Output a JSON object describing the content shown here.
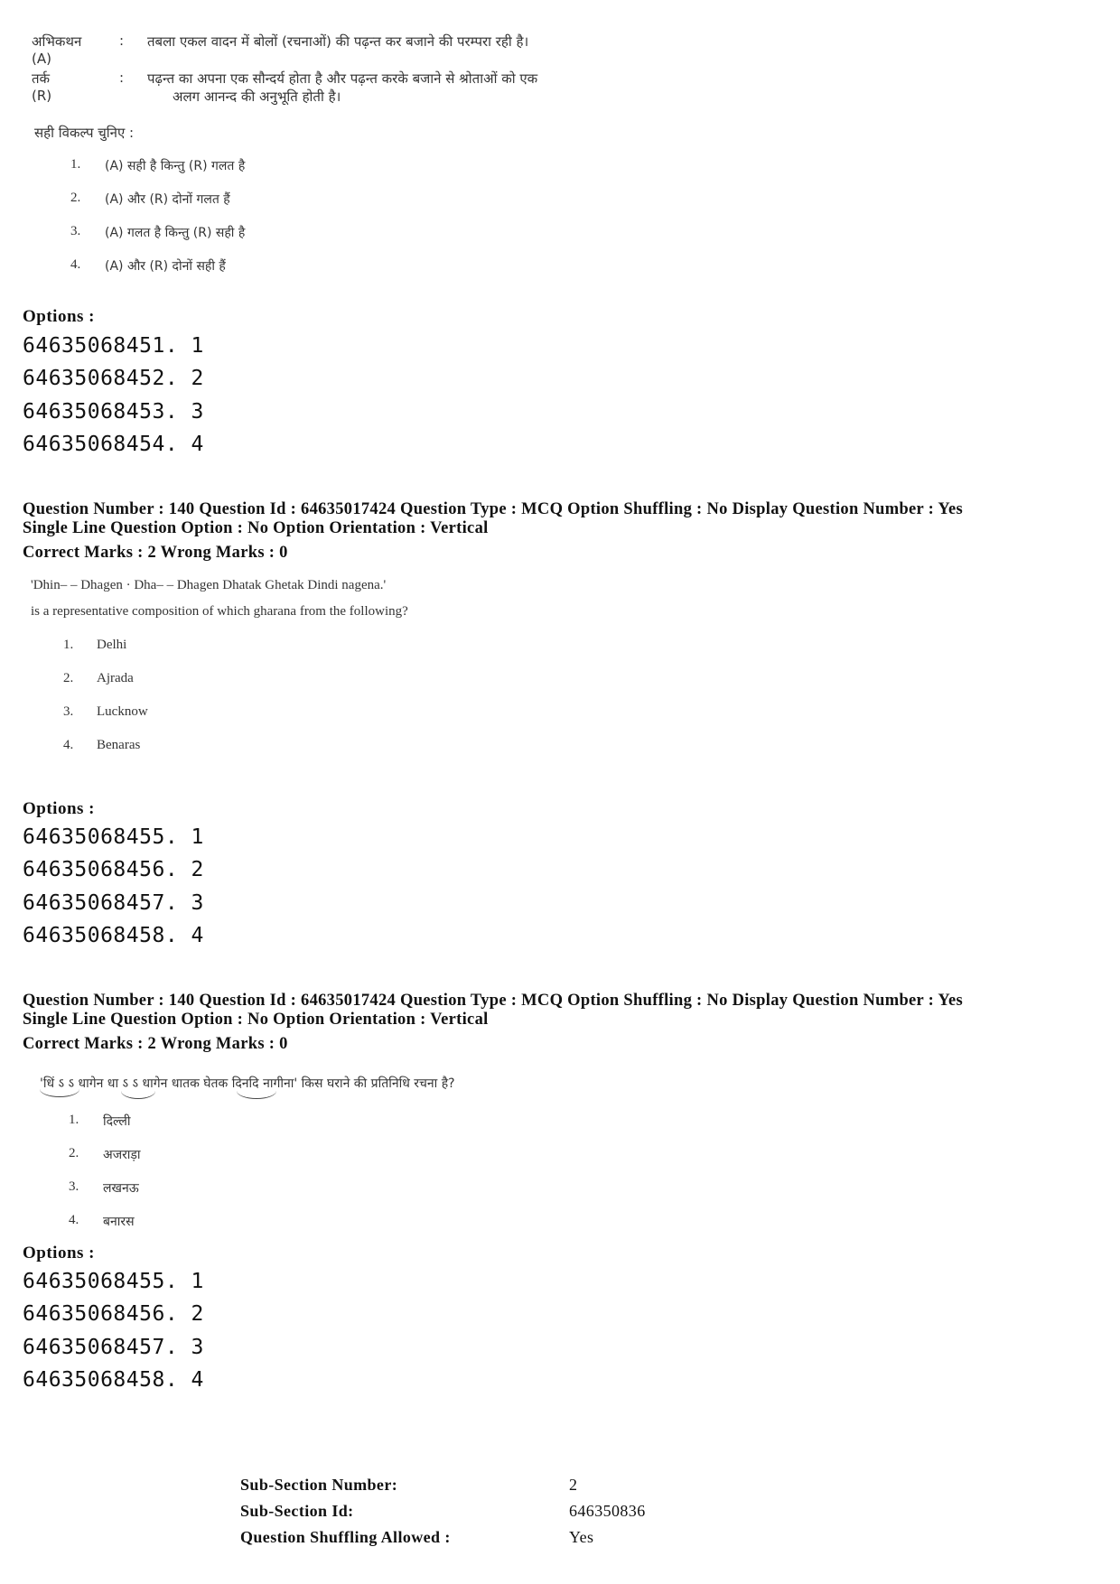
{
  "block1": {
    "assertion_label": "अभिकथन (A)",
    "assertion_colon": ":",
    "assertion_text": "तबला एकल वादन में बोलों (रचनाओं) की पढ़न्त कर बजाने की परम्परा रही है।",
    "reason_label": "तर्क (R)",
    "reason_colon": ":",
    "reason_text_line1": "पढ़न्त का अपना एक सौन्दर्य होता है और पढ़न्त करके बजाने से श्रोताओं को एक",
    "reason_text_line2": "अलग आनन्द की अनुभूति होती है।",
    "prompt": "सही विकल्प चुनिए :",
    "choices": [
      {
        "num": "1.",
        "text": "(A) सही है किन्तु (R) गलत है"
      },
      {
        "num": "2.",
        "text": "(A) और (R) दोनों गलत हैं"
      },
      {
        "num": "3.",
        "text": "(A) गलत है किन्तु (R)  सही है"
      },
      {
        "num": "4.",
        "text": "(A) और (R) दोनों सही हैं"
      }
    ],
    "options_heading": "Options :",
    "options": [
      "64635068451. 1",
      "64635068452. 2",
      "64635068453. 3",
      "64635068454. 4"
    ]
  },
  "block2": {
    "meta_line1": "Question Number : 140  Question Id : 64635017424  Question Type : MCQ  Option Shuffling : No  Display Question Number : Yes",
    "meta_line2": "Single Line Question Option : No  Option Orientation : Vertical",
    "marks_line": "Correct Marks : 2  Wrong Marks : 0",
    "question_line1": "'Dhin– – Dhagen · Dha– – Dhagen Dhatak Ghetak Dindi nagena.'",
    "question_line2": "is a representative composition of which gharana from the following?",
    "choices": [
      {
        "num": "1.",
        "text": "Delhi"
      },
      {
        "num": "2.",
        "text": "Ajrada"
      },
      {
        "num": "3.",
        "text": "Lucknow"
      },
      {
        "num": "4.",
        "text": "Benaras"
      }
    ],
    "options_heading": "Options :",
    "options": [
      "64635068455. 1",
      "64635068456. 2",
      "64635068457. 3",
      "64635068458. 4"
    ]
  },
  "block3": {
    "meta_line1": "Question Number : 140  Question Id : 64635017424  Question Type : MCQ  Option Shuffling : No  Display Question Number : Yes",
    "meta_line2": "Single Line Question Option : No  Option Orientation : Vertical",
    "marks_line": "Correct Marks : 2  Wrong Marks : 0",
    "question_line": "'धिं ऽ ऽ  धागेन धा ऽ ऽ धागेन धातक घेतक दिनदि नागीना' किस घराने की प्रतिनिधि रचना है?",
    "choices": [
      {
        "num": "1.",
        "text": "दिल्ली"
      },
      {
        "num": "2.",
        "text": "अजराड़ा"
      },
      {
        "num": "3.",
        "text": "लखनऊ"
      },
      {
        "num": "4.",
        "text": "बनारस"
      }
    ],
    "options_heading": "Options :",
    "options": [
      "64635068455. 1",
      "64635068456. 2",
      "64635068457. 3",
      "64635068458. 4"
    ]
  },
  "footer": {
    "rows": [
      {
        "key": "Sub-Section Number:",
        "value": "2"
      },
      {
        "key": "Sub-Section Id:",
        "value": "646350836"
      },
      {
        "key": "Question Shuffling Allowed :",
        "value": "Yes"
      }
    ]
  }
}
